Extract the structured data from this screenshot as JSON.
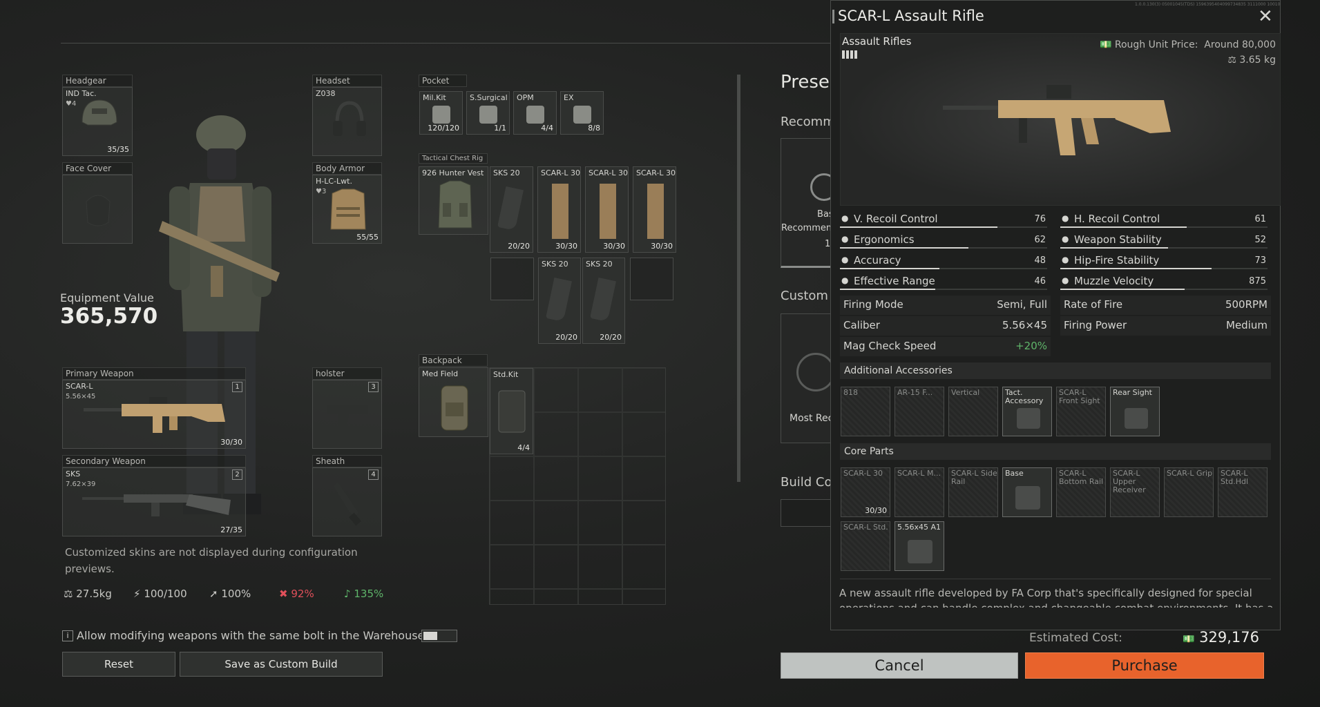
{
  "build_info": "1.0.0.130(3) 05001045(TDS) 1596395404099734835 3111000 100100 16|1920",
  "equipment": {
    "headgear": {
      "label": "Headgear",
      "item": "IND Tac.",
      "durability_icon": "4",
      "count": "35/35"
    },
    "headset": {
      "label": "Headset",
      "item": "Z038"
    },
    "face_cover": {
      "label": "Face Cover"
    },
    "body_armor": {
      "label": "Body Armor",
      "item": "H-LC-Lwt.",
      "durability_icon": "3",
      "count": "55/55"
    },
    "value_label": "Equipment Value",
    "value": "365,570",
    "primary": {
      "label": "Primary Weapon",
      "item": "SCAR-L",
      "caliber": "5.56×45",
      "slot_num": "1",
      "count": "30/30"
    },
    "secondary": {
      "label": "Secondary Weapon",
      "item": "SKS",
      "caliber": "7.62×39",
      "slot_num": "2",
      "count": "27/35"
    },
    "holster": {
      "label": "holster",
      "slot_num": "3"
    },
    "sheath": {
      "label": "Sheath",
      "slot_num": "4"
    },
    "skin_note": "Customized skins are not displayed during configuration previews.",
    "stats": {
      "weight": "27.5kg",
      "stamina": "100/100",
      "speed": "100%",
      "stat4": "92%",
      "stat5": "135%"
    },
    "bolt_note": "Allow modifying weapons with the same bolt in the Warehouse.",
    "reset_label": "Reset",
    "save_label": "Save as Custom Build"
  },
  "pocket": {
    "label": "Pocket",
    "items": [
      {
        "name": "Mil.Kit",
        "count": "120/120"
      },
      {
        "name": "S.Surgical",
        "count": "1/1"
      },
      {
        "name": "OPM",
        "count": "4/4"
      },
      {
        "name": "EX",
        "count": "8/8"
      }
    ]
  },
  "chest_rig": {
    "label": "Tactical Chest Rig",
    "vest": "926 Hunter Vest",
    "mags_row1": [
      {
        "name": "SKS 20",
        "count": "20/20"
      },
      {
        "name": "SCAR-L 30",
        "count": "30/30"
      },
      {
        "name": "SCAR-L 30",
        "count": "30/30"
      },
      {
        "name": "SCAR-L 30",
        "count": "30/30"
      }
    ],
    "mags_row2": [
      {
        "name": "SKS 20",
        "count": "20/20"
      },
      {
        "name": "SKS 20",
        "count": "20/20"
      }
    ]
  },
  "backpack": {
    "label": "Backpack",
    "bag": "Med Field",
    "item": {
      "name": "Std.Kit",
      "count": "4/4"
    }
  },
  "middle": {
    "preset_title": "Prese",
    "recommend": "Recomm",
    "base_card": "Bas",
    "base_card2": "Recommen",
    "base_card3": "1",
    "custom_title": "Custom",
    "most_rec": "Most Rec",
    "build_code": "Build Co"
  },
  "detail": {
    "title": "SCAR-L Assault Rifle",
    "category": "Assault Rifles",
    "price_label": "Rough Unit Price:",
    "price_value": "Around 80,000",
    "weight": "3.65 kg",
    "stats_left": [
      {
        "name": "V. Recoil Control",
        "value": "76",
        "icon": "vertical-recoil-icon"
      },
      {
        "name": "Ergonomics",
        "value": "62",
        "icon": "ergonomics-icon"
      },
      {
        "name": "Accuracy",
        "value": "48",
        "icon": "accuracy-icon"
      },
      {
        "name": "Effective Range",
        "value": "46",
        "icon": "range-icon"
      }
    ],
    "stats_right": [
      {
        "name": "H. Recoil Control",
        "value": "61",
        "icon": "horizontal-recoil-icon"
      },
      {
        "name": "Weapon Stability",
        "value": "52",
        "icon": "stability-icon"
      },
      {
        "name": "Hip-Fire Stability",
        "value": "73",
        "icon": "hipfire-icon"
      },
      {
        "name": "Muzzle Velocity",
        "value": "875",
        "icon": "velocity-icon"
      }
    ],
    "stat_fill_pct": {
      "V. Recoil Control": 76,
      "Ergonomics": 62,
      "Accuracy": 48,
      "Effective Range": 46,
      "H. Recoil Control": 61,
      "Weapon Stability": 52,
      "Hip-Fire Stability": 73,
      "Muzzle Velocity": 60
    },
    "attrs_left": [
      {
        "name": "Firing Mode",
        "value": "Semi, Full"
      },
      {
        "name": "Caliber",
        "value": "5.56×45"
      },
      {
        "name": "Mag Check Speed",
        "value": "+20%"
      }
    ],
    "attrs_right": [
      {
        "name": "Rate of Fire",
        "value": "500RPM"
      },
      {
        "name": "Firing Power",
        "value": "Medium"
      }
    ],
    "accessories_title": "Additional Accessories",
    "accessories": [
      {
        "name": "818",
        "filled": false
      },
      {
        "name": "AR-15 F...",
        "filled": false
      },
      {
        "name": "Vertical",
        "filled": false
      },
      {
        "name": "Tact. Accessory",
        "filled": true
      },
      {
        "name": "SCAR-L Front Sight",
        "filled": false
      },
      {
        "name": "Rear Sight",
        "filled": true
      }
    ],
    "core_title": "Core Parts",
    "core_parts": [
      {
        "name": "SCAR-L 30",
        "count": "30/30",
        "filled": false
      },
      {
        "name": "SCAR-L M...",
        "count": "",
        "filled": false
      },
      {
        "name": "SCAR-L Side Rail",
        "count": "",
        "filled": false
      },
      {
        "name": "Base",
        "count": "",
        "filled": true
      },
      {
        "name": "SCAR-L Bottom Rail",
        "count": "",
        "filled": false
      },
      {
        "name": "SCAR-L Upper Receiver",
        "count": "",
        "filled": false
      },
      {
        "name": "SCAR-L Grip",
        "count": "",
        "filled": false
      },
      {
        "name": "SCAR-L Std.Hdl",
        "count": "",
        "filled": false
      },
      {
        "name": "SCAR-L Std.",
        "count": "",
        "filled": false
      },
      {
        "name": "5.56x45 A1",
        "count": "",
        "filled": true
      }
    ],
    "description": "A new assault rifle developed by FA Corp that's specifically designed for special operations and can handle complex and changeable combat environments. It has a modular design and"
  },
  "footer": {
    "est_label": "Estimated Cost:",
    "est_value": "329,176",
    "cancel_label": "Cancel",
    "purchase_label": "Purchase"
  },
  "colors": {
    "accent": "#e8632c",
    "green": "#5fb56a",
    "red": "#e0505a"
  }
}
